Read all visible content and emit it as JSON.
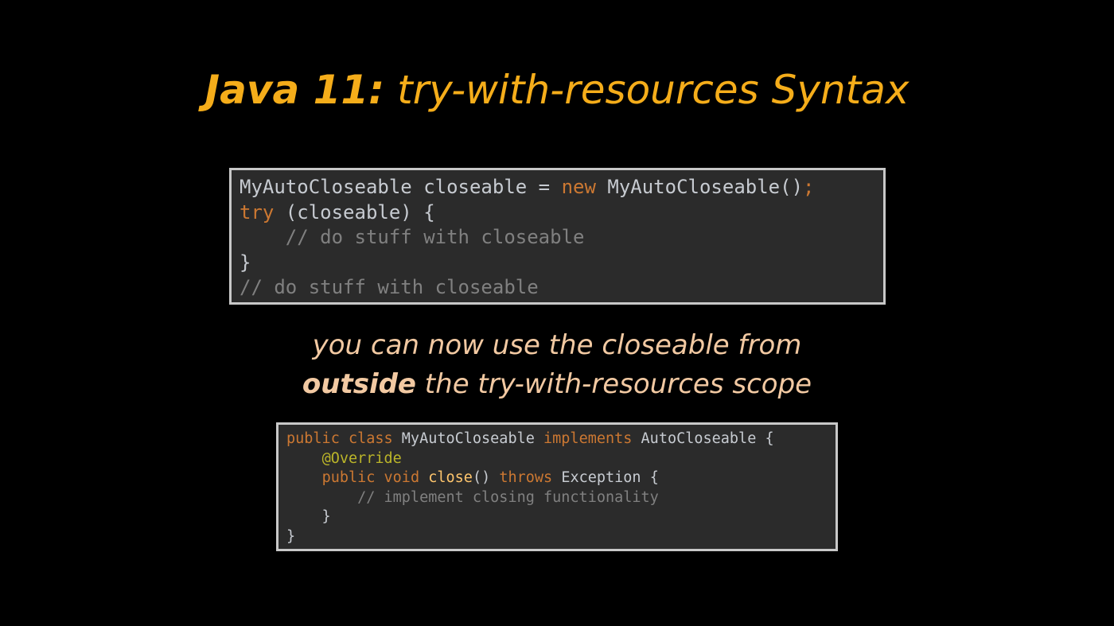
{
  "title": {
    "prefix": "Java 11:",
    "main": "try-with-resources Syntax"
  },
  "code_top": {
    "lines": [
      [
        {
          "t": "MyAutoCloseable closeable = ",
          "c": "plain"
        },
        {
          "t": "new",
          "c": "kw"
        },
        {
          "t": " MyAutoCloseable()",
          "c": "plain"
        },
        {
          "t": ";",
          "c": "kw"
        }
      ],
      [
        {
          "t": "try",
          "c": "kw"
        },
        {
          "t": " (closeable) {",
          "c": "plain"
        }
      ],
      [
        {
          "t": "    // do stuff with closeable",
          "c": "comment"
        }
      ],
      [
        {
          "t": "}",
          "c": "plain"
        }
      ],
      [
        {
          "t": "// do stuff with closeable",
          "c": "comment"
        }
      ]
    ]
  },
  "caption": {
    "line1": "you can now use the closeable from",
    "line2_bold": "outside",
    "line2_rest": " the try-with-resources scope"
  },
  "code_bottom": {
    "lines": [
      [
        {
          "t": "public class",
          "c": "kw"
        },
        {
          "t": " MyAutoCloseable ",
          "c": "plain"
        },
        {
          "t": "implements",
          "c": "kw"
        },
        {
          "t": " AutoCloseable {",
          "c": "plain"
        }
      ],
      [
        {
          "t": "    ",
          "c": "plain"
        },
        {
          "t": "@Override",
          "c": "annot"
        }
      ],
      [
        {
          "t": "    ",
          "c": "plain"
        },
        {
          "t": "public void",
          "c": "kw"
        },
        {
          "t": " ",
          "c": "plain"
        },
        {
          "t": "close",
          "c": "method"
        },
        {
          "t": "() ",
          "c": "plain"
        },
        {
          "t": "throws",
          "c": "kw"
        },
        {
          "t": " Exception {",
          "c": "plain"
        }
      ],
      [
        {
          "t": "        // implement closing functionality",
          "c": "comment"
        }
      ],
      [
        {
          "t": "    }",
          "c": "plain"
        }
      ],
      [
        {
          "t": "}",
          "c": "plain"
        }
      ]
    ]
  },
  "colors": {
    "background": "#000000",
    "title": "#f5ad1a",
    "caption": "#f2c9a2",
    "code_background": "#2b2b2b",
    "code_border": "#c8c8c8",
    "keyword": "#cc7832",
    "comment": "#808080",
    "annotation": "#bbb529",
    "method": "#ffc66d",
    "plain": "#c7cbd1"
  }
}
